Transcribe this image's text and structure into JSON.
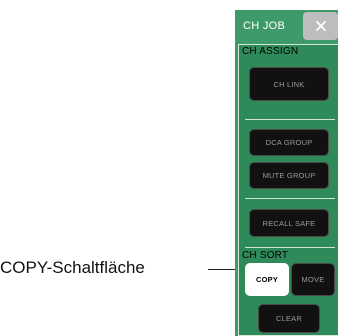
{
  "callout": {
    "label": "COPY-Schaltfläche"
  },
  "panel": {
    "title": "CH JOB",
    "close_icon": "close-icon"
  },
  "ch_assign": {
    "label": "CH ASSIGN",
    "ch_link": "CH LINK",
    "dca_group": "DCA GROUP",
    "mute_group": "MUTE GROUP",
    "recall_safe": "RECALL SAFE"
  },
  "ch_sort": {
    "label": "CH SORT",
    "copy": "COPY",
    "move": "MOVE",
    "clear": "CLEAR"
  },
  "colors": {
    "panel_green": "#3f9a69",
    "panel_body_green": "#2f8a5a",
    "button_black": "#111111",
    "button_active": "#ffffff",
    "close_gray": "#bdbdbd"
  }
}
